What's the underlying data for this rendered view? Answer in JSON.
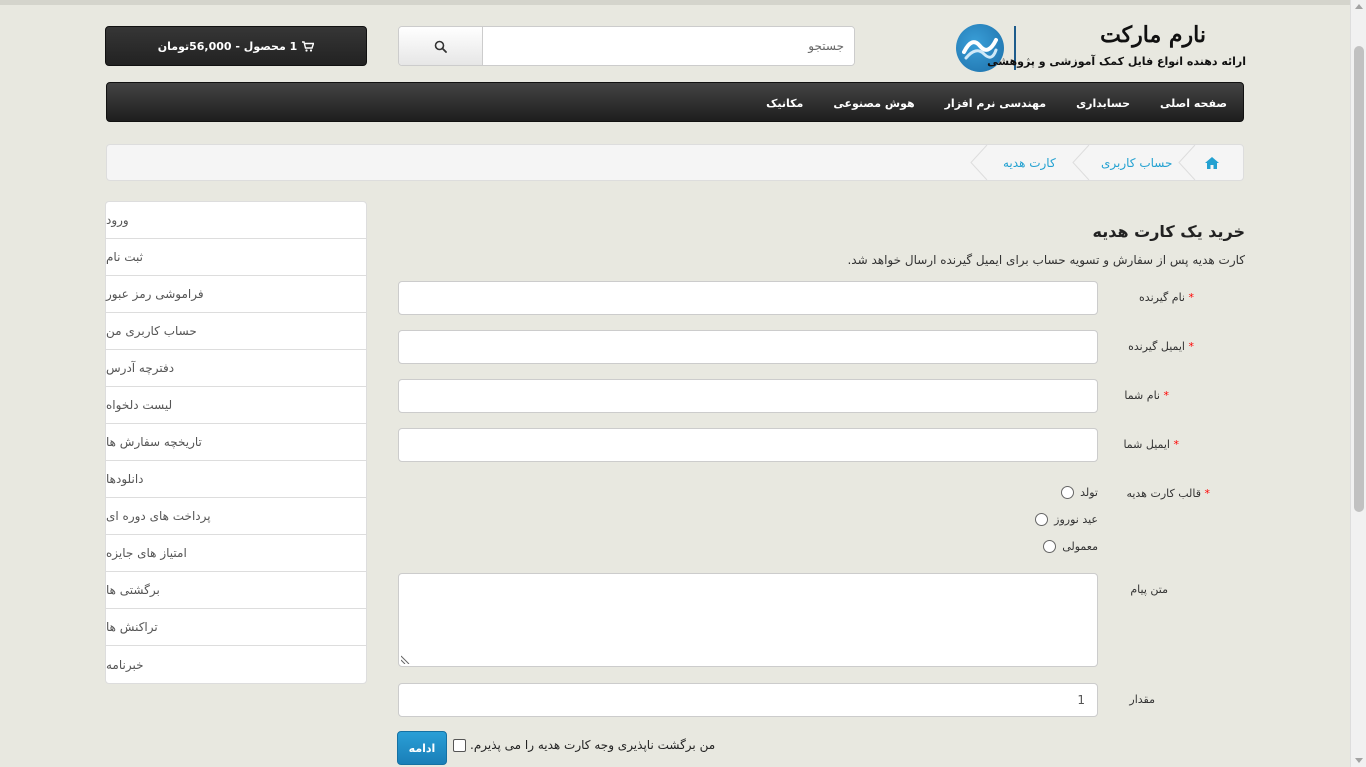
{
  "header": {
    "brand": "نارم مارکت",
    "tagline": "ارائه دهنده انواع فایل کمک آموزشی و پژوهشی",
    "search_placeholder": "جستجو",
    "cart_label": "1 محصول - 56,000تومان"
  },
  "nav": {
    "items": [
      "صفحه اصلی",
      "حسابداری",
      "مهندسی نرم افزار",
      "هوش مصنوعی",
      "مکانیک"
    ]
  },
  "breadcrumb": {
    "account": "حساب کاربری",
    "current": "کارت هدیه"
  },
  "sidebar": {
    "items": [
      "ورود",
      "ثبت نام",
      "فراموشی رمز عبور",
      "حساب کاربری من",
      "دفترچه آدرس",
      "لیست دلخواه",
      "تاریخچه سفارش ها",
      "دانلودها",
      "پرداخت های دوره ای",
      "امتیاز های جایزه",
      "برگشتی ها",
      "تراکنش ها",
      "خبرنامه"
    ]
  },
  "form": {
    "title": "خرید یک کارت هدیه",
    "description": "کارت هدیه پس از سفارش و تسویه حساب برای ایمیل گیرنده ارسال خواهد شد.",
    "required_mark": "*",
    "recipient_name_label": "نام گیرنده",
    "recipient_email_label": "ایمیل گیرنده",
    "your_name_label": "نام شما",
    "your_email_label": "ایمیل شما",
    "theme_label": "قالب کارت هدیه",
    "themes": [
      "تولد",
      "عید نوروز",
      "معمولی"
    ],
    "message_label": "متن پیام",
    "amount_label": "مقدار",
    "amount_value": "1",
    "agree_text": "من برگشت ناپذیری وجه کارت هدیه را می پذیرم.",
    "continue_label": "ادامه"
  },
  "colors": {
    "link": "#23a1d1",
    "primary_button": "#2a9fd6",
    "required": "#ff0000",
    "nav_bg": "#2a2a2a"
  }
}
